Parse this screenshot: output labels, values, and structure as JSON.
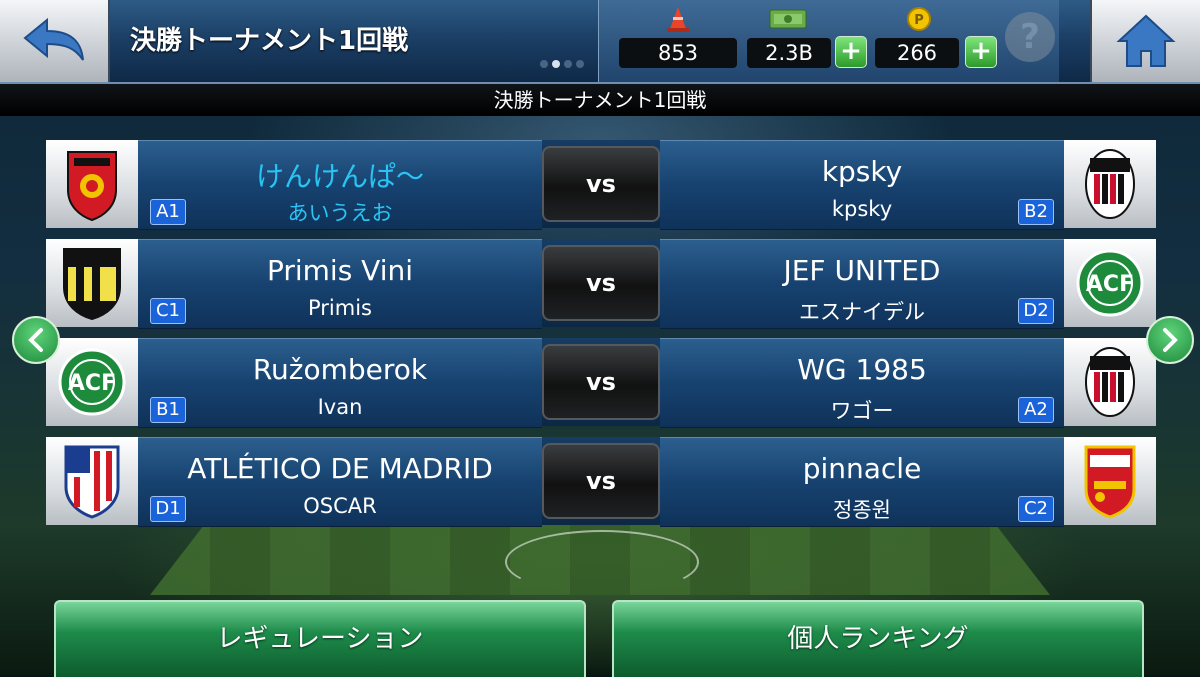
{
  "header": {
    "title": "決勝トーナメント1回戦",
    "stats": {
      "cones": "853",
      "money": "2.3B",
      "points": "266"
    },
    "help_label": "?"
  },
  "subtitle": "決勝トーナメント1回戦",
  "matches": [
    {
      "home": {
        "team": "けんけんぱ〜",
        "player": "あいうえお",
        "seed": "A1",
        "crest": "red-crest-icon"
      },
      "vs": "vs",
      "away": {
        "team": "kpsky",
        "player": "kpsky",
        "seed": "B2",
        "crest": "acm-crest-icon"
      }
    },
    {
      "home": {
        "team": "Primis Vini",
        "player": "Primis",
        "seed": "C1",
        "crest": "black-white-crest-icon"
      },
      "vs": "vs",
      "away": {
        "team": "JEF UNITED",
        "player": "エスナイデル",
        "seed": "D2",
        "crest": "green-crest-icon"
      }
    },
    {
      "home": {
        "team": "Ružomberok",
        "player": "Ivan",
        "seed": "B1",
        "crest": "green-crest-icon"
      },
      "vs": "vs",
      "away": {
        "team": "WG 1985",
        "player": "ワゴー",
        "seed": "A2",
        "crest": "acm-crest-icon"
      }
    },
    {
      "home": {
        "team": "ATLÉTICO DE MADRID",
        "player": "OSCAR",
        "seed": "D1",
        "crest": "atletico-crest-icon"
      },
      "vs": "vs",
      "away": {
        "team": "pinnacle",
        "player": "정종원",
        "seed": "C2",
        "crest": "arsenal-crest-icon"
      }
    }
  ],
  "buttons": {
    "regulation": "レギュレーション",
    "ranking": "個人ランキング"
  },
  "colors": {
    "accent_green": "#1e8c4b",
    "highlight_cyan": "#29c4f3",
    "seed_blue": "#1a63d8"
  }
}
